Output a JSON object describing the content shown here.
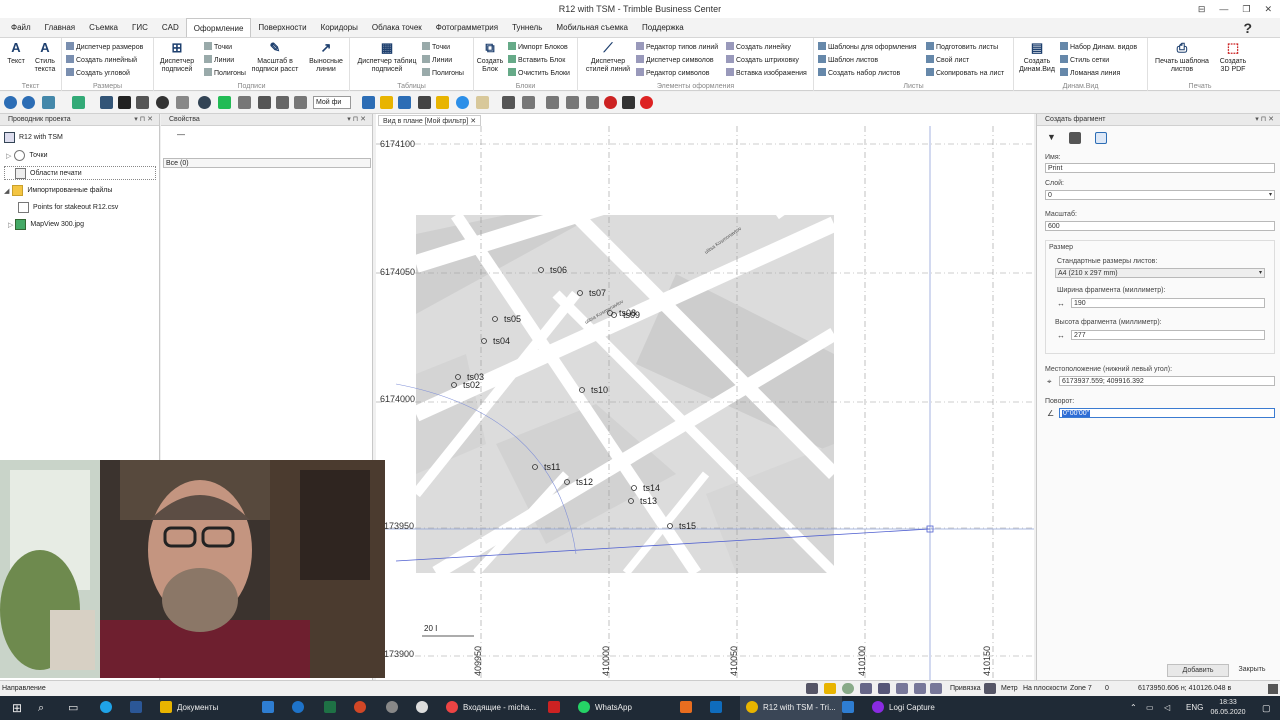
{
  "window": {
    "title": "R12 with TSM - Trimble Business Center",
    "controls": [
      "⊟",
      "—",
      "❐",
      "✕"
    ]
  },
  "menu": {
    "items": [
      "Файл",
      "Главная",
      "Съемка",
      "ГИС",
      "CAD",
      "Оформление",
      "Поверхности",
      "Коридоры",
      "Облака точек",
      "Фотограмметрия",
      "Туннель",
      "Мобильная съемка",
      "Поддержка"
    ],
    "active": "Оформление",
    "help": "?"
  },
  "ribbon": {
    "text_big1": "Текст",
    "text_big2": "Стиль текста",
    "group_text": "Текст",
    "dims_1": "Диспетчер размеров",
    "dims_2": "Создать линейный",
    "dims_3": "Создать угловой",
    "group_dims": "Размеры",
    "labels_big1": "Диспетчер подписей",
    "labels_s1": "Точки",
    "labels_s2": "Линии",
    "labels_s3": "Полигоны",
    "labels_big2": "Масштаб в подписи расст",
    "labels_big3": "Выносные линии",
    "group_labels": "Подписи",
    "tables_big": "Диспетчер таблиц подписей",
    "tables_s1": "Точки",
    "tables_s2": "Линии",
    "tables_s3": "Полигоны",
    "group_tables": "Таблицы",
    "blocks_big": "Создать Блок",
    "blocks_s1": "Импорт Блоков",
    "blocks_s2": "Вставить Блок",
    "blocks_s3": "Очистить Блоки",
    "group_blocks": "Блоки",
    "styles_big": "Диспетчер стилей линий",
    "styles_s1": "Редактор типов линий",
    "styles_s2": "Диспетчер символов",
    "styles_s3": "Редактор символов",
    "styles_s4": "Создать линейку",
    "styles_s5": "Создать штриховку",
    "styles_s6": "Вставка изображения",
    "group_styles": "Элементы оформления",
    "sheets_s1": "Шаблоны для оформления",
    "sheets_s2": "Шаблон листов",
    "sheets_s3": "Создать набор листов",
    "sheets_s4": "Подготовить листы",
    "sheets_s5": "Свой лист",
    "sheets_s6": "Скопировать на лист",
    "group_sheets": "Листы",
    "dyn_big": "Создать Динам.Вид",
    "dyn_s1": "Набор Динам. видов",
    "dyn_s2": "Стиль сетки",
    "dyn_s3": "Ломаная линия",
    "group_dyn": "Динам.Вид",
    "print_big1": "Печать шаблона листов",
    "print_big2": "Создать 3D PDF",
    "group_print": "Печать"
  },
  "toolbar2": {
    "filter_value": "Мой фи"
  },
  "project_explorer": {
    "title": "Проводник проекта",
    "items": [
      "R12 with TSM",
      "Точки",
      "Области печати",
      "Импортированные файлы",
      "Points for stakeout R12.csv",
      "MapView 300.jpg"
    ]
  },
  "properties": {
    "title": "Свойства",
    "dash": "—",
    "filter": "Все (0)"
  },
  "map": {
    "tab": "Вид в плане [Мой фильтр]",
    "y_labels": [
      "6174100",
      "6174050",
      "6174000",
      "173950",
      "173900"
    ],
    "x_labels": [
      "409950",
      "410000",
      "410050",
      "410100",
      "410150"
    ],
    "points": [
      "ts06",
      "ts07",
      "ts08",
      "ts09",
      "ts05",
      "ts04",
      "ts03",
      "ts02",
      "ts10",
      "ts11",
      "ts12",
      "ts14",
      "ts13",
      "ts15"
    ],
    "scale_label": "20 I",
    "street_label_1": "ulitsa Kosmonavtov",
    "street_label_2": "ulitsa Kosmonavtov"
  },
  "create_fragment": {
    "title": "Создать фрагмент",
    "name_label": "Имя:",
    "name_value": "Print",
    "layer_label": "Слой:",
    "layer_value": "0",
    "scale_label": "Масштаб:",
    "scale_value": "600",
    "size_label": "Размер",
    "std_sizes_label": "Стандартные размеры листов:",
    "std_sizes_value": "A4 (210 x 297 mm)",
    "width_label": "Ширина фрагмента (миллиметр):",
    "width_value": "190",
    "height_label": "Высота фрагмента (миллиметр):",
    "height_value": "277",
    "location_label": "Местоположение (нижний левый угол):",
    "location_value": "6173937.559; 409916.392",
    "rotation_label": "Поворот:",
    "rotation_value": "0°00'00\"",
    "add_button": "Добавить",
    "close_button": "Закрыть"
  },
  "statusbar": {
    "left": "Направление",
    "snap": "Привязка",
    "units": "Метр",
    "plane": "На плоскости",
    "zone": "Zone 7",
    "zero": "0",
    "coords": "6173950.606 н; 410126.048 в"
  },
  "taskbar": {
    "items": [
      "Документы",
      "Входящие - micha...",
      "WhatsApp",
      "R12 with TSM - Tri...",
      "Logi Capture"
    ],
    "lang": "ENG",
    "time": "18:33",
    "date": "06.05.2020"
  },
  "colors": {
    "accent": "#1e5aa8",
    "map_bg": "#ddd",
    "road": "#ffffff",
    "building": "#c8c8c8"
  }
}
